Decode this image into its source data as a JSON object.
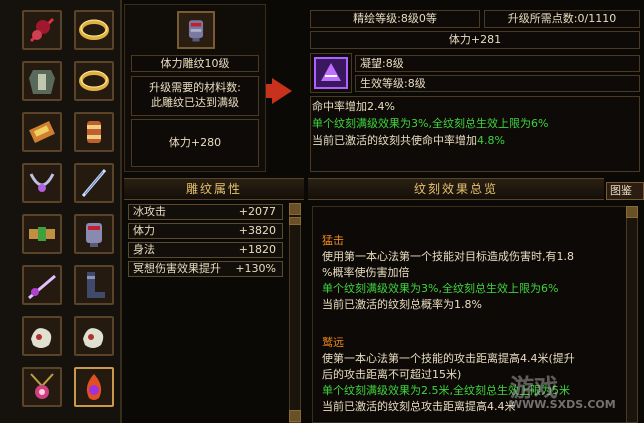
{
  "slots": [
    {
      "icon": "red-feather-icon",
      "col": 0,
      "row": 0
    },
    {
      "icon": "gold-ring-icon",
      "col": 1,
      "row": 0
    },
    {
      "icon": "armor-icon",
      "col": 0,
      "row": 1
    },
    {
      "icon": "gold-ring-icon",
      "col": 1,
      "row": 1
    },
    {
      "icon": "scroll-icon",
      "col": 0,
      "row": 2
    },
    {
      "icon": "bracer-icon",
      "col": 1,
      "row": 2
    },
    {
      "icon": "necklace-icon",
      "col": 0,
      "row": 3
    },
    {
      "icon": "blade-icon",
      "col": 1,
      "row": 3
    },
    {
      "icon": "belt-icon",
      "col": 0,
      "row": 4
    },
    {
      "icon": "gauntlet-icon",
      "col": 1,
      "row": 4
    },
    {
      "icon": "sword-icon",
      "col": 0,
      "row": 5
    },
    {
      "icon": "boots-icon",
      "col": 1,
      "row": 5
    },
    {
      "icon": "jade-pendant-icon",
      "col": 0,
      "row": 6
    },
    {
      "icon": "jade-pendant-icon",
      "col": 1,
      "row": 6
    },
    {
      "icon": "amulet-icon",
      "col": 0,
      "row": 7
    },
    {
      "icon": "flame-gem-icon",
      "col": 1,
      "row": 7
    }
  ],
  "mid": {
    "title": "体力雕纹10级",
    "material_label": "升级需要的材料数:",
    "material_value": "此雕纹已达到满级",
    "stat": "体力+280"
  },
  "top": {
    "level": "精绘等级:8级0等",
    "points": "升级所需点数:0/1110",
    "stat": "体力+281",
    "gem_name": "凝望:8级",
    "effect_level": "生效等级:8级",
    "lines": [
      {
        "text": "命中率增加2.4%",
        "color": "white"
      },
      {
        "text": "单个纹刻满级效果为3%,全纹刻总生效上限为6%",
        "color": "green"
      },
      {
        "text": "当前已激活的纹刻共使命中率增加4.8%",
        "color": "white",
        "highlight": "4.8%"
      }
    ]
  },
  "attr_panel": {
    "title": "雕纹属性",
    "rows": [
      {
        "name": "冰攻击",
        "value": "+2077"
      },
      {
        "name": "体力",
        "value": "+3820"
      },
      {
        "name": "身法",
        "value": "+1820"
      },
      {
        "name": "冥想伤害效果提升",
        "value": "+130%"
      }
    ]
  },
  "effect_panel": {
    "title": "纹刻效果总览",
    "tab": "图鉴",
    "sections": [
      {
        "name": "猛击",
        "lines": [
          {
            "text": "使用第一本心法第一个技能对目标造成伤害时,有1.8",
            "color": "white"
          },
          {
            "text": "%概率使伤害加倍",
            "color": "white"
          },
          {
            "text": "单个纹刻满级效果为3%,全纹刻总生效上限为6%",
            "color": "green"
          },
          {
            "text": "当前已激活的纹刻总概率为1.8%",
            "color": "white"
          }
        ]
      },
      {
        "name": "鹫远",
        "lines": [
          {
            "text": "使第一本心法第一个技能的攻击距离提高4.4米(提升",
            "color": "white"
          },
          {
            "text": "后的攻击距离不可超过15米)",
            "color": "white"
          },
          {
            "text": "单个纹刻满级效果为2.5米,全纹刻总生效上限为5米",
            "color": "green"
          },
          {
            "text": "当前已激活的纹刻总攻击距离提高4.4米",
            "color": "white"
          }
        ]
      }
    ]
  },
  "watermark": {
    "main": "游戏",
    "sub": "WWW.SXDS.COM"
  }
}
